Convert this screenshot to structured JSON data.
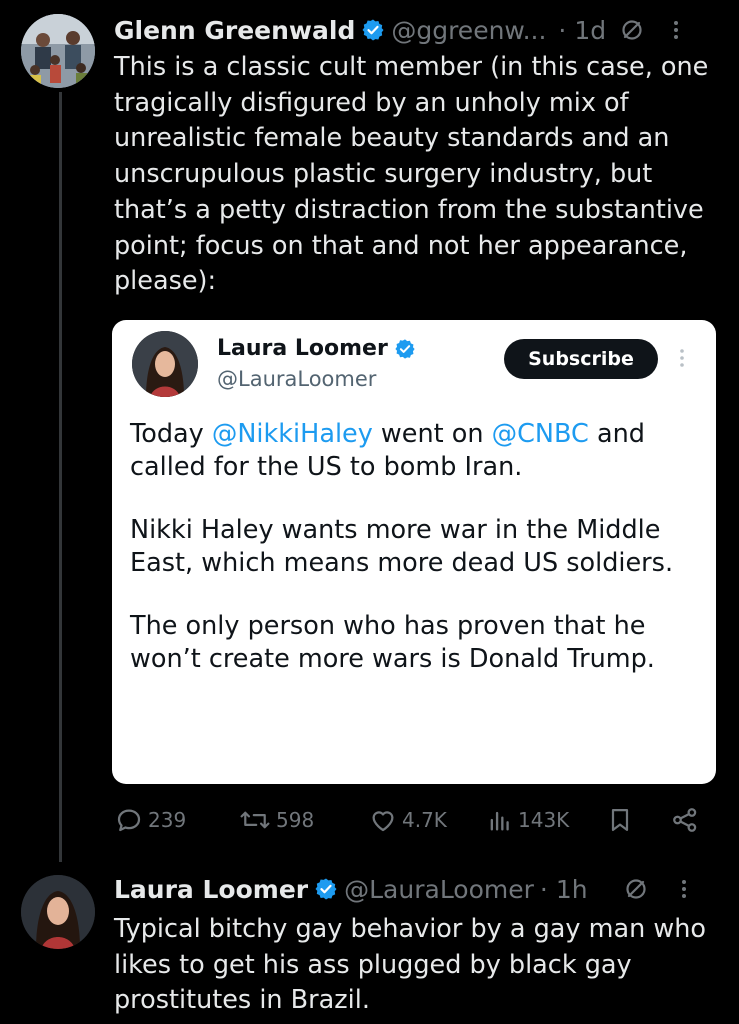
{
  "tweet": {
    "author_name": "Glenn Greenwald",
    "author_handle": "@ggreenw...",
    "time": "· 1d",
    "text": "This is a classic cult member (in this case, one tragically disfigured by an unholy mix of unrealistic female beauty standards and an unscrupulous plastic surgery industry, but that’s a petty distraction from the substantive point; focus on that and not her appearance, please):",
    "avatar_icon": "family-photo-avatar",
    "grok_icon": "grok-icon",
    "more_icon": "more-vertical-icon"
  },
  "quoted": {
    "author_name": "Laura Loomer",
    "author_handle": "@LauraLoomer",
    "subscribe_label": "Subscribe",
    "paragraphs": [
      {
        "before": "Today ",
        "mention1": "@NikkiHaley",
        "middle": " went on ",
        "mention2": "@CNBC",
        "after": " and called for the US to bomb Iran."
      },
      {
        "text": "Nikki Haley wants more war in the Middle East, which means more dead US soldiers."
      },
      {
        "text": "The only person who has proven that he won’t create more wars is Donald Trump."
      }
    ]
  },
  "actions": {
    "replies": "239",
    "reposts": "598",
    "likes": "4.7K",
    "views": "143K"
  },
  "reply": {
    "author_name": "Laura Loomer",
    "author_handle": "@LauraLoomer",
    "time": "· 1h",
    "text": "Typical bitchy gay behavior by a gay man who likes to get his ass plugged by black gay prostitutes in Brazil."
  },
  "colors": {
    "background": "#000000",
    "text": "#e7e9ea",
    "muted": "#71767b",
    "accent": "#1d9bf0",
    "thread_line": "#333639"
  }
}
